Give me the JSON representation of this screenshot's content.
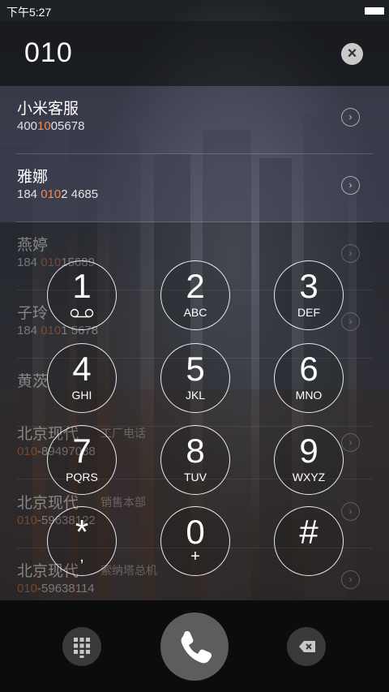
{
  "status": {
    "time": "下午5:27"
  },
  "dialed_number": "010",
  "icons": {
    "clear": "close-icon",
    "chevron": "chevron-right-icon",
    "voicemail": "voicemail-icon",
    "call": "phone-icon",
    "keypad": "keypad-grid-icon",
    "backspace": "backspace-icon"
  },
  "results": [
    {
      "name": "小米客服",
      "tag": "",
      "num_parts": [
        "400",
        "10",
        "05678"
      ]
    },
    {
      "name": "雅娜",
      "tag": "",
      "num_parts": [
        "184 ",
        "010",
        "2 4685"
      ]
    },
    {
      "name": "燕婷",
      "tag": "",
      "num_parts": [
        "184 ",
        "010",
        "15689"
      ]
    },
    {
      "name": "子玲",
      "tag": "",
      "num_parts": [
        "184 ",
        "010",
        "1 5678"
      ]
    },
    {
      "name": "黄茨",
      "tag": "",
      "num_parts": [
        "",
        "",
        ""
      ]
    },
    {
      "name": "北京现代",
      "tag": "工厂电话",
      "num_parts": [
        "",
        "010",
        "-89497088"
      ]
    },
    {
      "name": "北京现代",
      "tag": "销售本部",
      "num_parts": [
        "",
        "010",
        "-59638122"
      ]
    },
    {
      "name": "北京现代",
      "tag": "索纳塔总机",
      "num_parts": [
        "",
        "010",
        "-59638114"
      ]
    }
  ],
  "keys": [
    {
      "digit": "1",
      "letters": ""
    },
    {
      "digit": "2",
      "letters": "ABC"
    },
    {
      "digit": "3",
      "letters": "DEF"
    },
    {
      "digit": "4",
      "letters": "GHI"
    },
    {
      "digit": "5",
      "letters": "JKL"
    },
    {
      "digit": "6",
      "letters": "MNO"
    },
    {
      "digit": "7",
      "letters": "PQRS"
    },
    {
      "digit": "8",
      "letters": "TUV"
    },
    {
      "digit": "9",
      "letters": "WXYZ"
    },
    {
      "digit": "*",
      "letters": ","
    },
    {
      "digit": "0",
      "letters": "+"
    },
    {
      "digit": "#",
      "letters": ""
    }
  ],
  "colors": {
    "highlight": "#f08a4e",
    "accent_bar": "#6e6e96"
  }
}
